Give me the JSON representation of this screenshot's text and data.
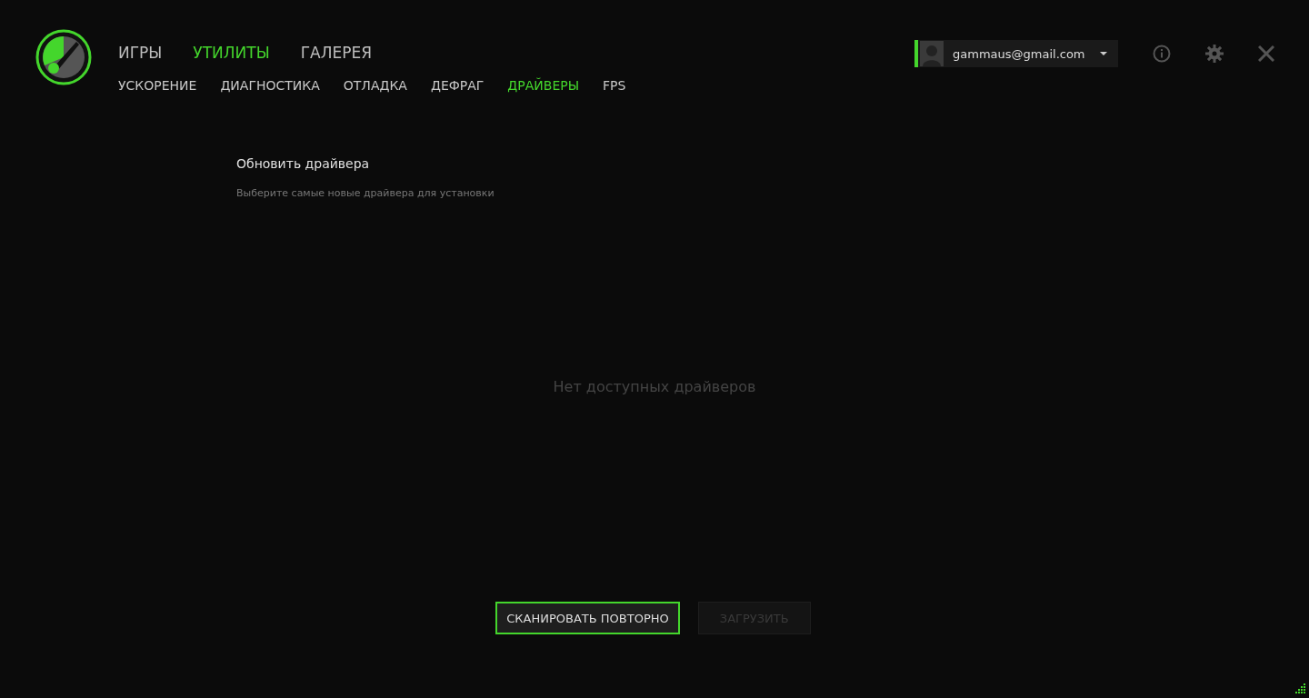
{
  "main_tabs": [
    {
      "label": "ИГРЫ",
      "selected": false
    },
    {
      "label": "УТИЛИТЫ",
      "selected": true
    },
    {
      "label": "ГАЛЕРЕЯ",
      "selected": false
    }
  ],
  "sub_tabs": [
    {
      "label": "УСКОРЕНИЕ",
      "selected": false
    },
    {
      "label": "ДИАГНОСТИКА",
      "selected": false
    },
    {
      "label": "ОТЛАДКА",
      "selected": false
    },
    {
      "label": "ДЕФРАГ",
      "selected": false
    },
    {
      "label": "ДРАЙВЕРЫ",
      "selected": true
    },
    {
      "label": "FPS",
      "selected": false
    }
  ],
  "account": {
    "email": "gammaus@gmail.com"
  },
  "section": {
    "title": "Обновить драйвера",
    "subtitle": "Выберите самые новые драйвера для установки"
  },
  "empty_message": "Нет доступных драйверов",
  "buttons": [
    {
      "label": "СКАНИРОВАТЬ ПОВТОРНО",
      "disabled": false
    },
    {
      "label": "ЗАГРУЗИТЬ",
      "disabled": true
    }
  ]
}
